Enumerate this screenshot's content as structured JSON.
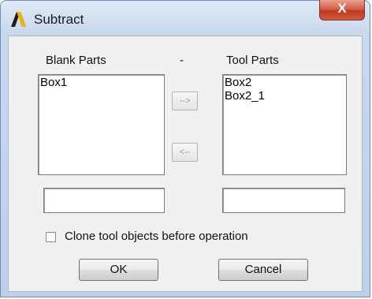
{
  "window": {
    "title": "Subtract",
    "app_icon": "ansys-logo-icon",
    "close_icon": "close-icon",
    "close_label": "X"
  },
  "blank_parts": {
    "label": "Blank Parts",
    "items": [
      "Box1"
    ],
    "text_value": ""
  },
  "separator_label": "-",
  "tool_parts": {
    "label": "Tool Parts",
    "items": [
      "Box2",
      "Box2_1"
    ],
    "text_value": ""
  },
  "move_right_label": "-->",
  "move_left_label": "<--",
  "clone_option": {
    "label": "Clone tool objects before operation",
    "checked": false
  },
  "ok_label": "OK",
  "cancel_label": "Cancel"
}
